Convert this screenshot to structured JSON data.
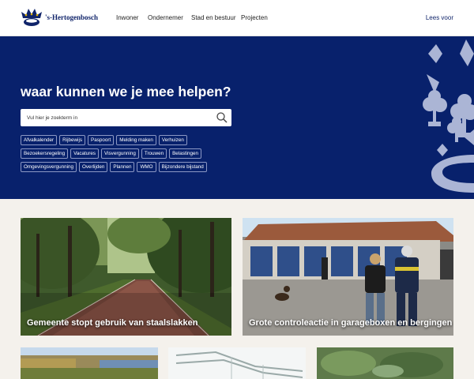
{
  "header": {
    "brand": "'s-Hertogenbosch",
    "nav": [
      "Inwoner",
      "Ondernemer",
      "Stad en bestuur",
      "Projecten"
    ],
    "read_aloud": "Lees voor"
  },
  "hero": {
    "title": "waar kunnen we je mee helpen?",
    "search": {
      "placeholder": "Vul hier je zoekterm in",
      "value": ""
    },
    "chip_rows": [
      [
        "Afvalkalender",
        "Rijbewijs",
        "Paspoort",
        "Melding maken",
        "Verhuizen"
      ],
      [
        "Bezoekersregeling",
        "Vacatures",
        "Visvergunning",
        "Trouwen",
        "Belastingen"
      ],
      [
        "Omgevingsvergunning",
        "Overlijden",
        "Plannen",
        "WMO",
        "Bijzondere bijstand"
      ]
    ]
  },
  "news": [
    {
      "title": "Gemeente stopt gebruik van staalslakken"
    },
    {
      "title": "Grote controleactie in garageboxen en bergingen"
    }
  ],
  "colors": {
    "brand": "#08216c",
    "header_bg": "#ffffff",
    "page_bg": "#f4f1ec"
  }
}
